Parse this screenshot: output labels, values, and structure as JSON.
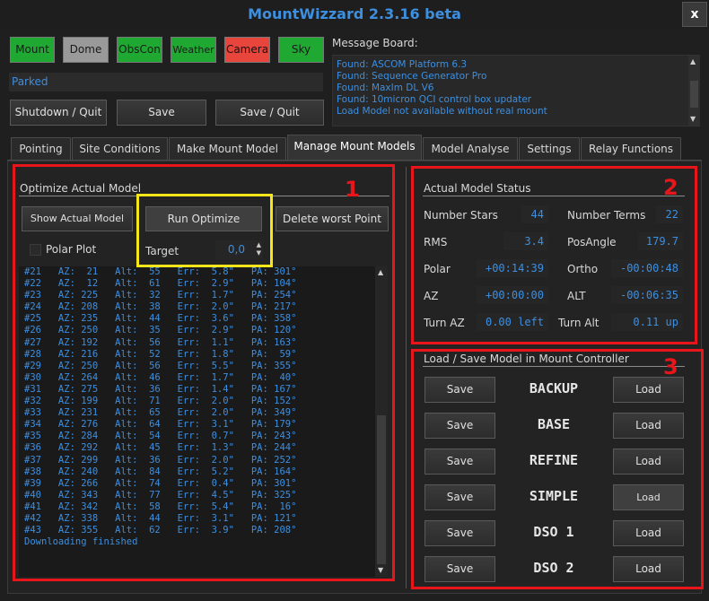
{
  "window": {
    "title": "MountWizzard 2.3.16 beta",
    "close_label": "x"
  },
  "devices": [
    {
      "label": "Mount",
      "state": "green"
    },
    {
      "label": "Dome",
      "state": "gray"
    },
    {
      "label": "ObsCon",
      "state": "green"
    },
    {
      "label": "Weather",
      "state": "green"
    },
    {
      "label": "Camera",
      "state": "red"
    },
    {
      "label": "Sky",
      "state": "green"
    }
  ],
  "status_text": "Parked",
  "actions": {
    "shutdown": "Shutdown / Quit",
    "save": "Save",
    "save_quit": "Save / Quit"
  },
  "message_board": {
    "label": "Message Board:",
    "lines": [
      "Found: ASCOM Platform 6.3",
      "Found: Sequence Generator Pro",
      "Found: MaxIm DL V6",
      "Found: 10micron QCI control box updater",
      "Load Model not available without real mount"
    ]
  },
  "tabs": [
    "Pointing",
    "Site Conditions",
    "Make Mount Model",
    "Manage Mount Models",
    "Model Analyse",
    "Settings",
    "Relay Functions"
  ],
  "active_tab": "Manage Mount Models",
  "annotations": [
    "1",
    "2",
    "3"
  ],
  "optimize": {
    "title": "Optimize Actual Model",
    "show_model": "Show Actual Model",
    "run_optimize": "Run Optimize",
    "delete_worst": "Delete worst Point",
    "polar_plot": "Polar Plot",
    "target_label": "Target",
    "target_value": "0,0"
  },
  "log_lines": [
    "#21   AZ:  21   Alt:  55   Err:  5.8\"   PA: 301°",
    "#22   AZ:  12   Alt:  61   Err:  2.9\"   PA: 104°",
    "#23   AZ: 225   Alt:  32   Err:  1.7\"   PA: 254°",
    "#24   AZ: 208   Alt:  38   Err:  2.0\"   PA: 217°",
    "#25   AZ: 235   Alt:  44   Err:  3.6\"   PA: 358°",
    "#26   AZ: 250   Alt:  35   Err:  2.9\"   PA: 120°",
    "#27   AZ: 192   Alt:  56   Err:  1.1\"   PA: 163°",
    "#28   AZ: 216   Alt:  52   Err:  1.8\"   PA:  59°",
    "#29   AZ: 250   Alt:  56   Err:  5.5\"   PA: 355°",
    "#30   AZ: 264   Alt:  46   Err:  1.7\"   PA:  40°",
    "#31   AZ: 275   Alt:  36   Err:  1.4\"   PA: 167°",
    "#32   AZ: 199   Alt:  71   Err:  2.0\"   PA: 152°",
    "#33   AZ: 231   Alt:  65   Err:  2.0\"   PA: 349°",
    "#34   AZ: 276   Alt:  64   Err:  3.1\"   PA: 179°",
    "#35   AZ: 284   Alt:  54   Err:  0.7\"   PA: 243°",
    "#36   AZ: 292   Alt:  45   Err:  1.3\"   PA: 244°",
    "#37   AZ: 299   Alt:  36   Err:  2.0\"   PA: 252°",
    "#38   AZ: 240   Alt:  84   Err:  5.2\"   PA: 164°",
    "#39   AZ: 266   Alt:  74   Err:  0.4\"   PA: 301°",
    "#40   AZ: 343   Alt:  77   Err:  4.5\"   PA: 325°",
    "#41   AZ: 342   Alt:  58   Err:  5.4\"   PA:  16°",
    "#42   AZ: 338   Alt:  44   Err:  3.1\"   PA: 121°",
    "#43   AZ: 355   Alt:  62   Err:  3.9\"   PA: 208°",
    "Downloading finished"
  ],
  "status": {
    "title": "Actual Model Status",
    "number_stars": {
      "label": "Number Stars",
      "value": "44"
    },
    "number_terms": {
      "label": "Number Terms",
      "value": "22"
    },
    "rms": {
      "label": "RMS",
      "value": "3.4"
    },
    "posangle": {
      "label": "PosAngle",
      "value": "179.7"
    },
    "polar": {
      "label": "Polar",
      "value": "+00:14:39"
    },
    "ortho": {
      "label": "Ortho",
      "value": "-00:00:48"
    },
    "az": {
      "label": "AZ",
      "value": "+00:00:00"
    },
    "alt": {
      "label": "ALT",
      "value": "-00:06:35"
    },
    "turn_az": {
      "label": "Turn AZ",
      "value": "0.00 left"
    },
    "turn_alt": {
      "label": "Turn Alt",
      "value": "0.11 up"
    }
  },
  "models": {
    "title": "Load / Save Model in Mount Controller",
    "save_label": "Save",
    "load_label": "Load",
    "names": [
      "BACKUP",
      "BASE",
      "REFINE",
      "SIMPLE",
      "DSO 1",
      "DSO 2"
    ]
  },
  "colors": {
    "accent_blue": "#3d8fe0",
    "green": "#1fa832",
    "red": "#e8453c",
    "annotation_red": "#e8161b",
    "annotation_yellow": "#f6e61a"
  }
}
